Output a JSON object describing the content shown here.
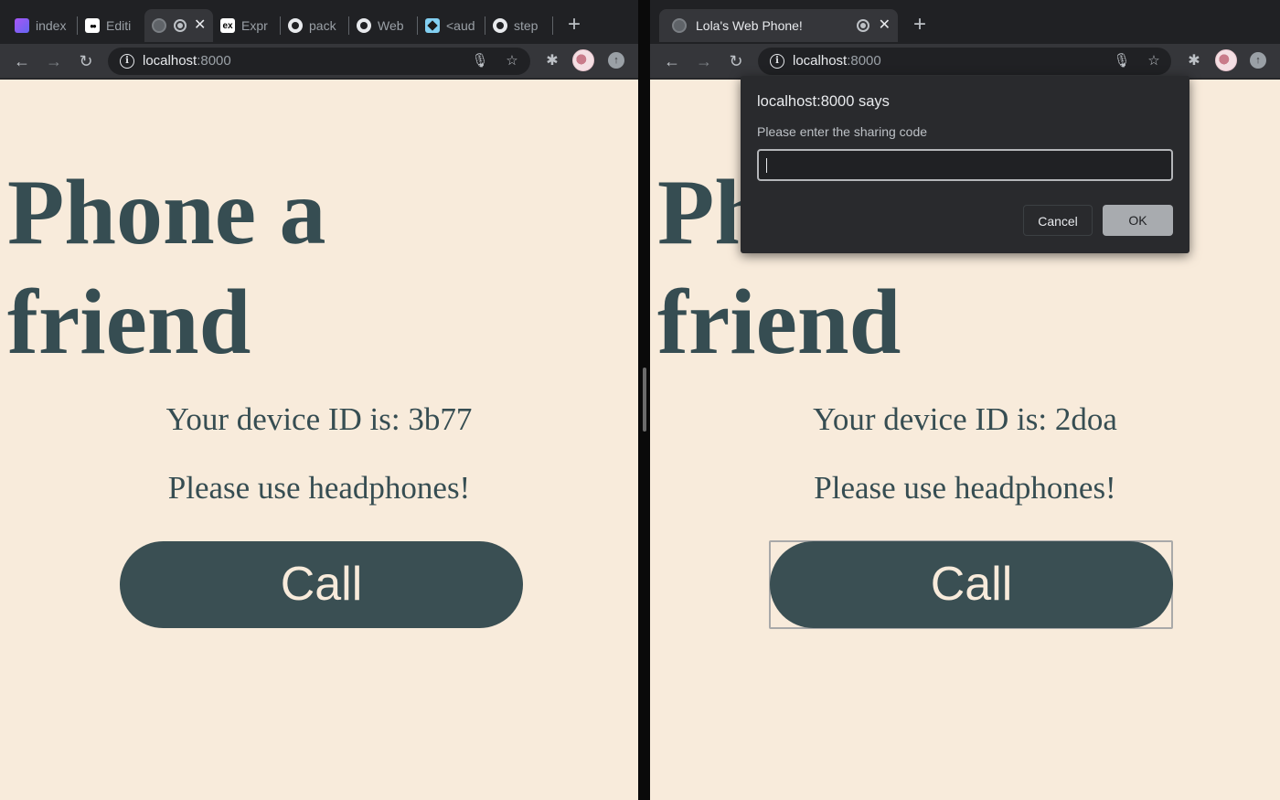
{
  "left_window": {
    "tabs": [
      {
        "title": "index",
        "icon": "layers-icon"
      },
      {
        "title": "Editi",
        "icon": "medium-icon"
      },
      {
        "title": "",
        "icon": "globe-icon",
        "active": true
      },
      {
        "title": "Expr",
        "icon": "express-icon"
      },
      {
        "title": "pack",
        "icon": "github-icon"
      },
      {
        "title": "Web",
        "icon": "github-icon"
      },
      {
        "title": "<aud",
        "icon": "mdn-icon"
      },
      {
        "title": "step",
        "icon": "github-icon"
      }
    ],
    "address": {
      "host": "localhost",
      "port": ":8000"
    },
    "page": {
      "heading_line1": "Phone a",
      "heading_line2": "friend",
      "device_id": "Your device ID is: 3b77",
      "headphones": "Please use headphones!",
      "call_label": "Call"
    }
  },
  "right_window": {
    "tabs": [
      {
        "title": "Lola's Web Phone!",
        "icon": "globe-icon",
        "active": true
      }
    ],
    "address": {
      "host": "localhost",
      "port": ":8000"
    },
    "page": {
      "heading_line1": "Phone a",
      "heading_line2": "friend",
      "device_id": "Your device ID is: 2doa",
      "headphones": "Please use headphones!",
      "call_label": "Call"
    },
    "dialog": {
      "title": "localhost:8000 says",
      "message": "Please enter the sharing code",
      "input_value": "",
      "cancel_label": "Cancel",
      "ok_label": "OK"
    }
  },
  "colors": {
    "page_background": "#f8ebdb",
    "heading_text": "#364d52",
    "call_button": "#3a4f53",
    "browser_chrome": "#35363a"
  }
}
